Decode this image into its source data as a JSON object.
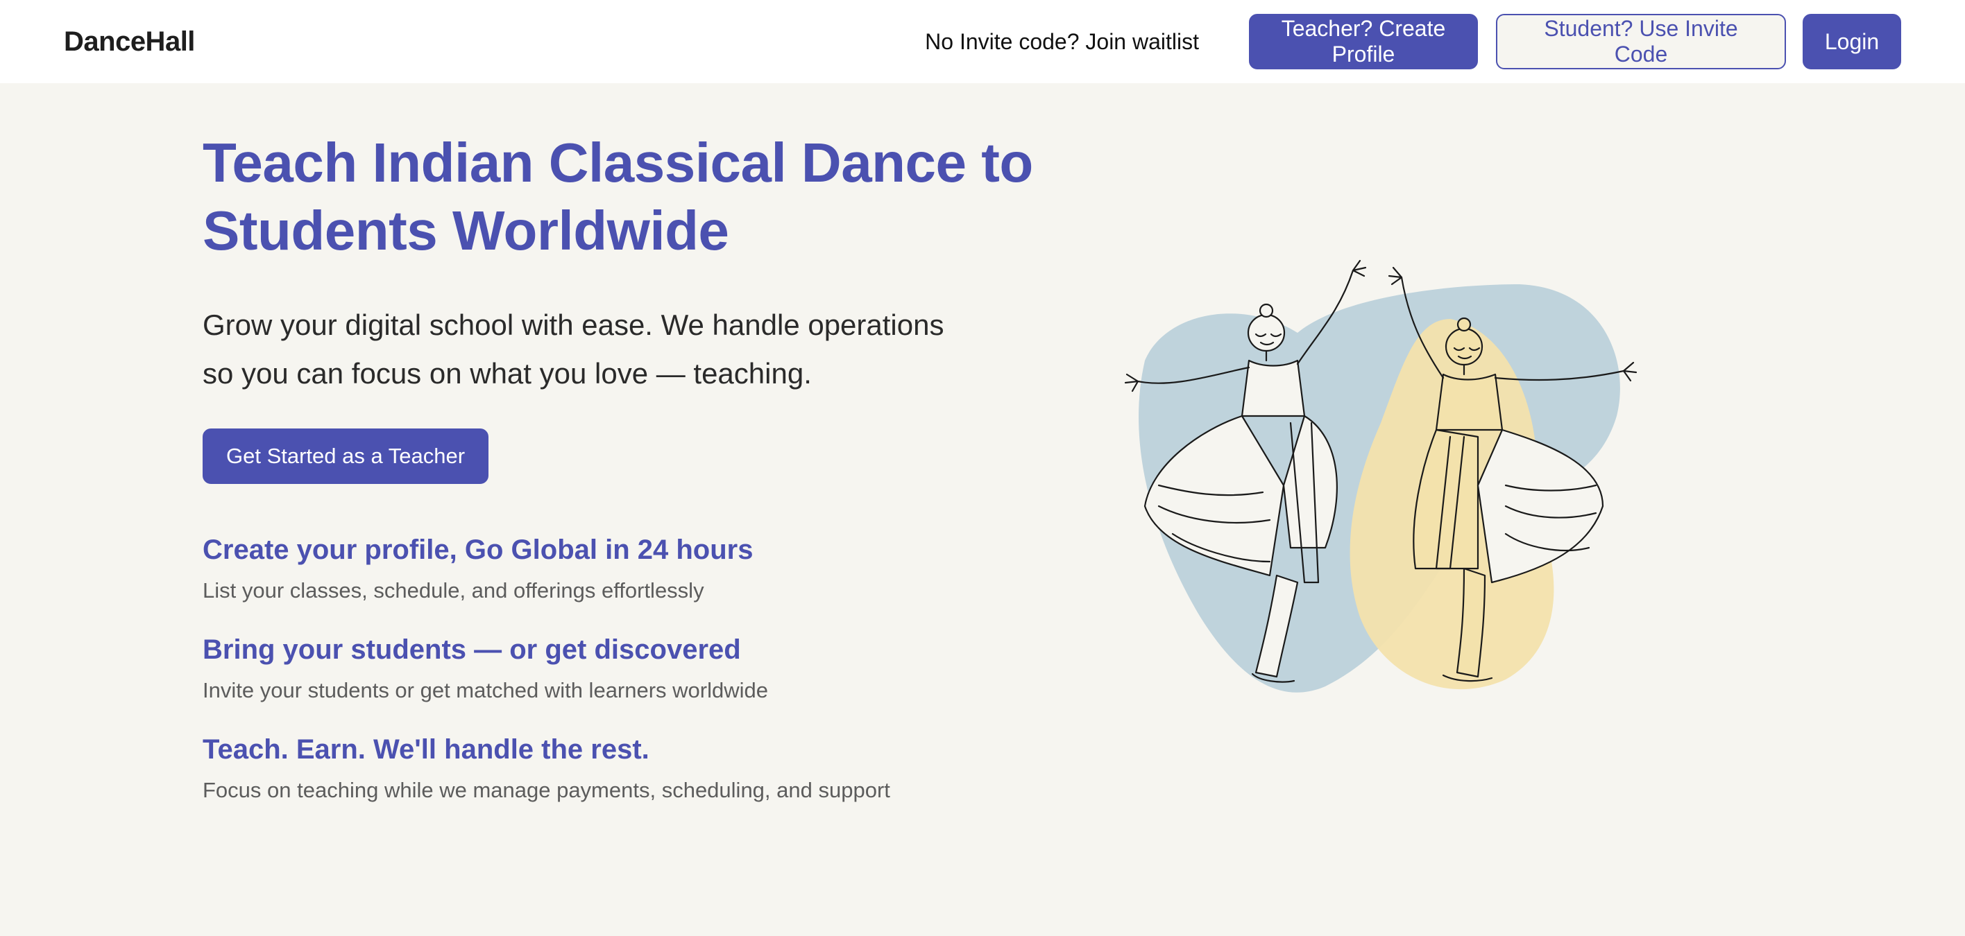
{
  "nav": {
    "logo": "DanceHall",
    "waitlist_link": "No Invite code? Join waitlist",
    "teacher_button": "Teacher? Create Profile",
    "student_button": "Student? Use Invite Code",
    "login_button": "Login"
  },
  "hero": {
    "title_line1": "Teach Indian Classical Dance to",
    "title_line2": "Students Worldwide",
    "subtitle_line1": "Grow your digital school with ease. We handle operations",
    "subtitle_line2": "so you can focus on what you love — teaching.",
    "cta_label": "Get Started as a Teacher"
  },
  "features": [
    {
      "title": "Create your profile, Go Global in 24 hours",
      "description": "List your classes, schedule, and offerings effortlessly"
    },
    {
      "title": "Bring your students — or get discovered",
      "description": "Invite your students or get matched with learners worldwide"
    },
    {
      "title": "Teach. Earn. We'll handle the rest.",
      "description": "Focus on teaching while we manage payments, scheduling, and support"
    }
  ],
  "colors": {
    "accent": "#4b51b0",
    "background": "#f6f5f0",
    "blob_blue": "#bfd3dc",
    "blob_yellow": "#f3e2ac"
  },
  "illustration": {
    "icon": "dancers-illustration"
  }
}
